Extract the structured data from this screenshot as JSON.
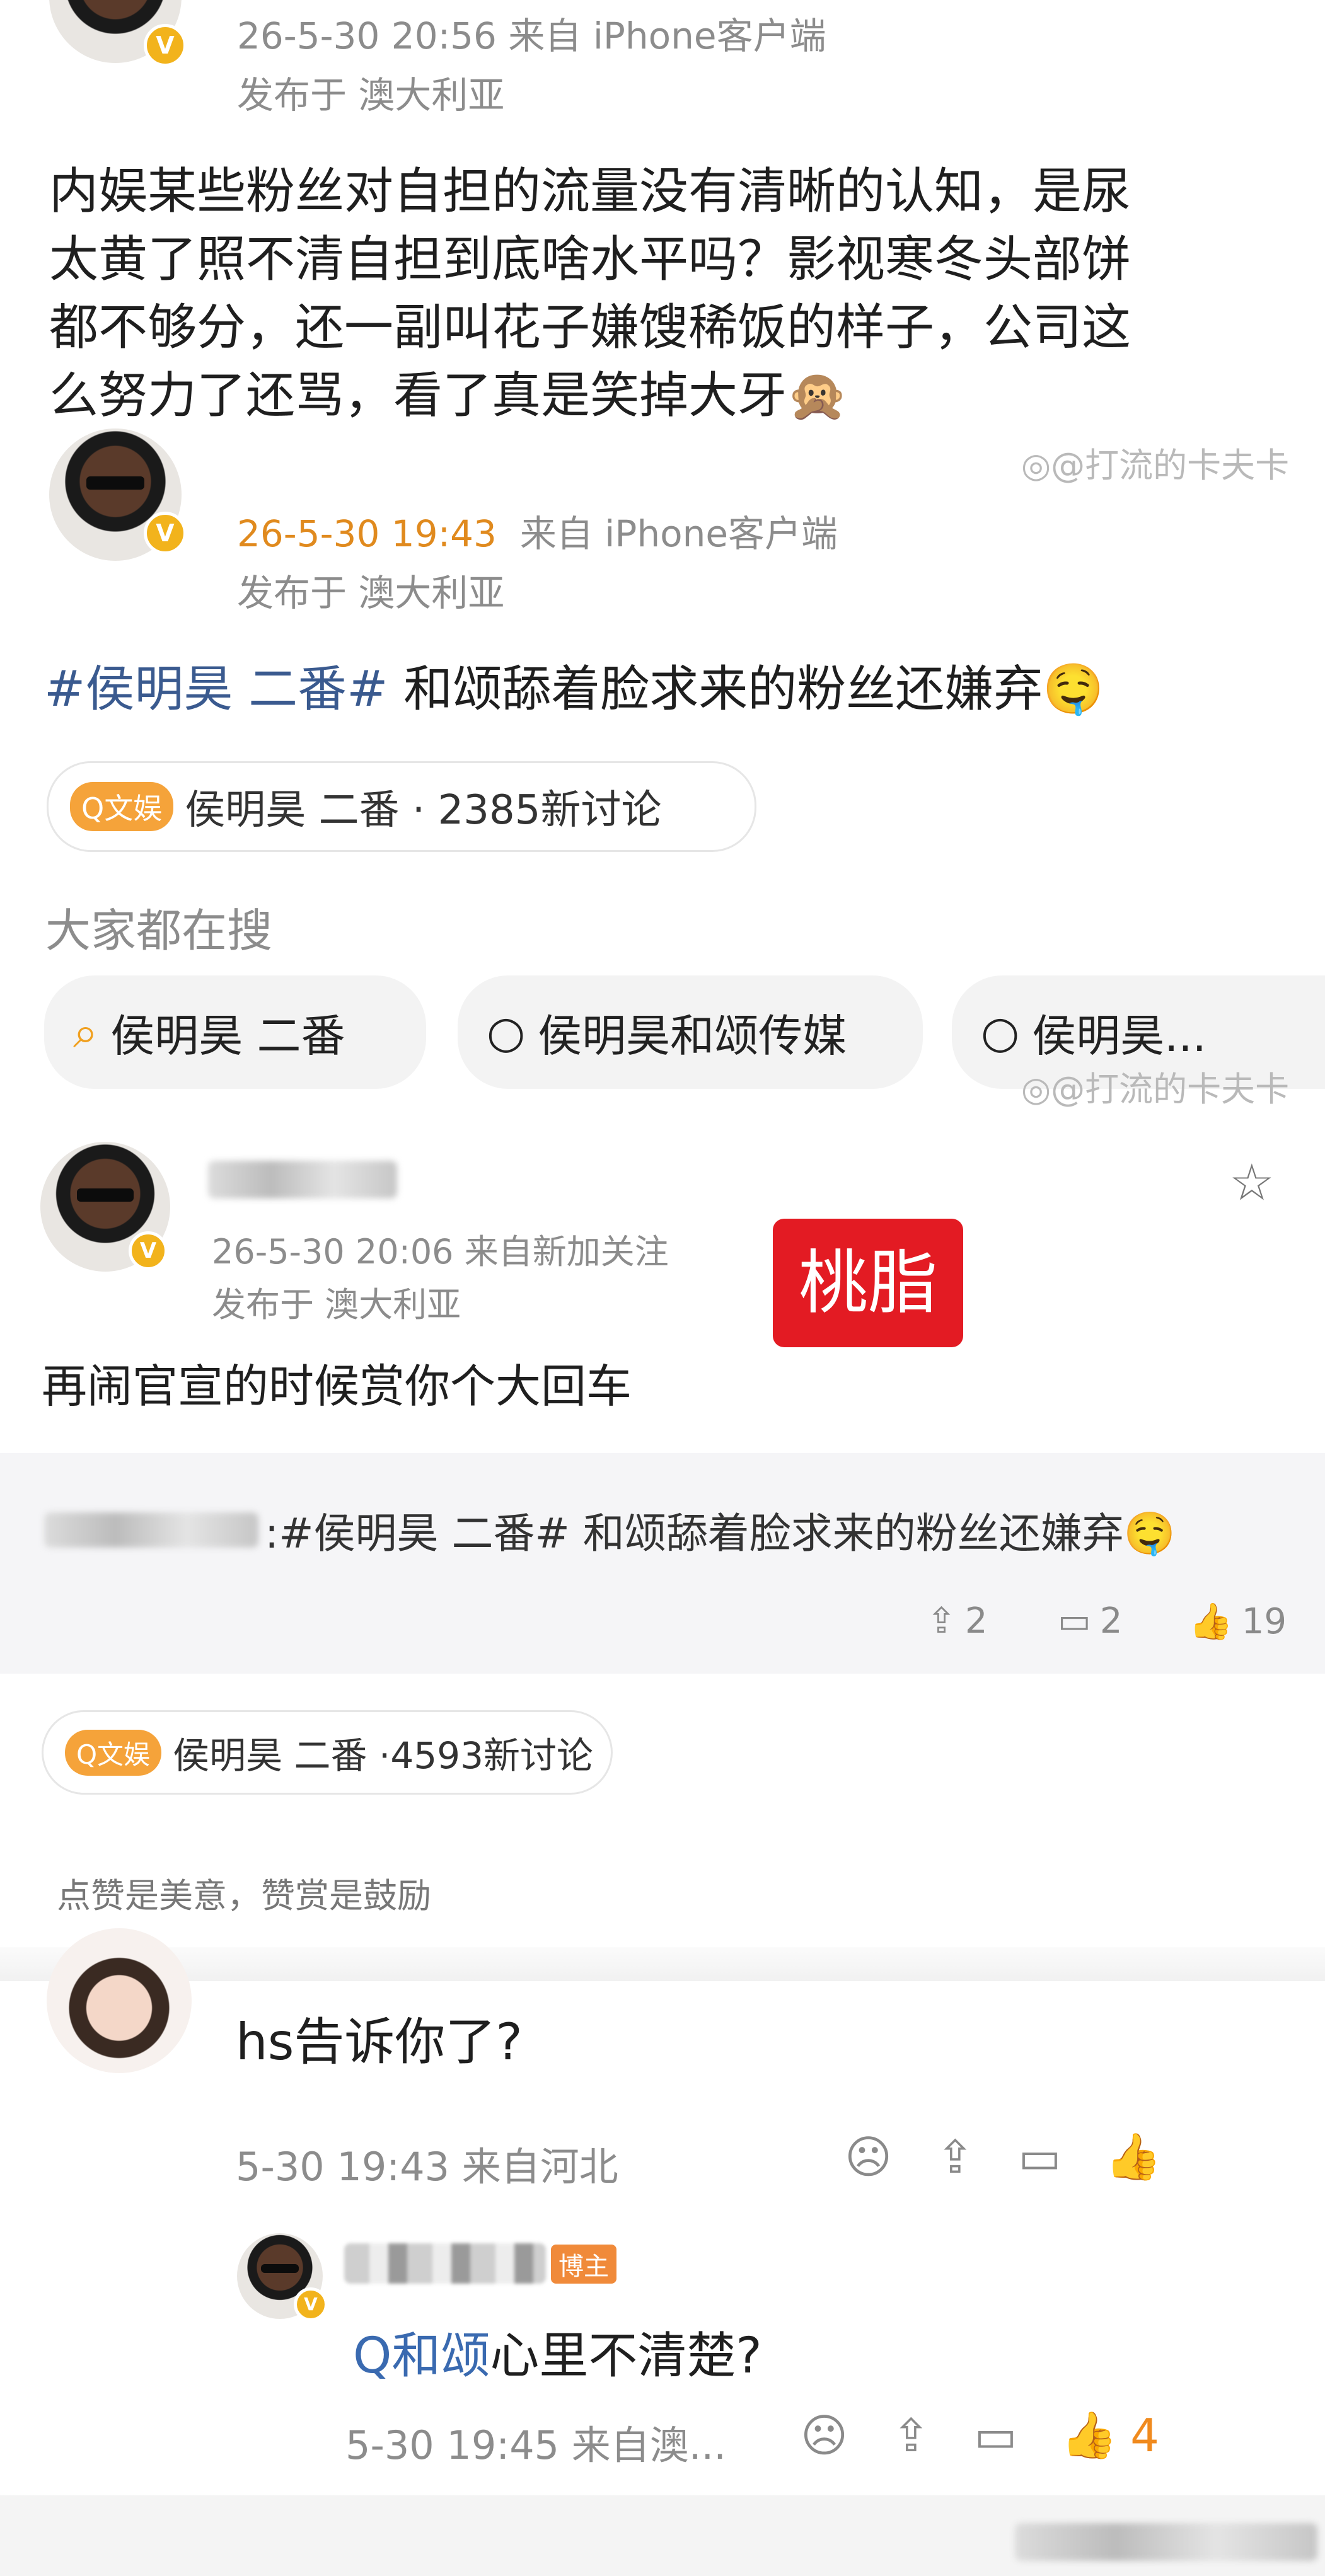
{
  "post1": {
    "meta_time": "26-5-30 20:56  来自 iPhone客户端",
    "location": "发布于  澳大利亚",
    "body_lines": [
      "内娱某些粉丝对自担的流量没有清晰的认知，是尿",
      "太黄了照不清自担到底啥水平吗？影视寒冬头部饼",
      "都不够分，还一副叫花子嫌馊稀饭的样子，公司这",
      "么努力了还骂，看了真是笑掉大牙🙊"
    ]
  },
  "watermark": "@打流的卡夫卡",
  "post2": {
    "meta_time": "26-5-30 19:43",
    "meta_source": "来自 iPhone客户端",
    "location": "发布于 澳大利亚",
    "hashtag": "#侯明昊 二番#",
    "text": " 和颂舔着脸求来的粉丝还嫌弃🤤",
    "topic_badge": "Q文娱",
    "topic_text": "侯明昊 二番 · 2385新讨论",
    "search_title": "大家都在搜",
    "chips": [
      "侯明昊 二番",
      "侯明昊和颂传媒",
      "侯明昊..."
    ]
  },
  "post3": {
    "name": "瑞文",
    "meta_time": "26-5-30 20:06  来自新加关注",
    "location": "发布于 澳大利亚",
    "red_label": "桃脂",
    "text": "再闹官宣的时候赏你个大回车",
    "repost_tail": ":#侯明昊 二番# 和颂舔着脸求来的粉丝还嫌弃🤤",
    "stats": {
      "repost": "2",
      "comment": "2",
      "like": "19"
    },
    "topic_badge": "Q文娱",
    "topic_text": "侯明昊 二番 ·4593新讨论",
    "reward_text": "点赞是美意，赞赏是鼓励"
  },
  "comment1": {
    "text": "hs告诉你了?",
    "meta": "5-30 19:43  来自河北"
  },
  "reply1": {
    "tag": "博主",
    "prefix": "Q和颂",
    "text": "心里不清楚?",
    "meta": "5-30 19:45  来自澳...",
    "likes": "4"
  },
  "colors": {
    "accent_orange": "#e08a1e",
    "hashtag_blue": "#3a5a8f",
    "red_label": "#e31b23",
    "vip_gold": "#f2b31c"
  }
}
